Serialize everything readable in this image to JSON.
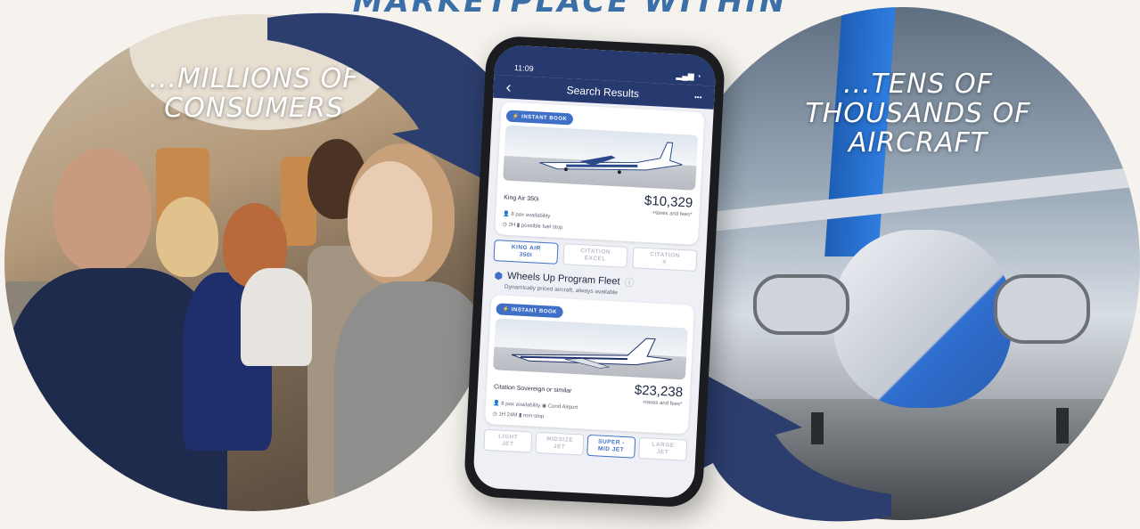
{
  "headline": "MARKETPLACE WITHIN",
  "left_panel": {
    "line1": "...MILLIONS OF",
    "line2": "CONSUMERS"
  },
  "right_panel": {
    "line1": "...TENS OF",
    "line2": "THOUSANDS OF AIRCRAFT"
  },
  "phone": {
    "status_time": "11:09",
    "nav_title": "Search Results",
    "nav_back": "‹",
    "nav_more": "•••",
    "card1": {
      "badge": "⚡ INSTANT BOOK",
      "aircraft": "King Air 350i",
      "price": "$10,329",
      "price_note": "+taxes and fees*",
      "pax": "8 pax availability",
      "duration": "2H",
      "stop": "possible fuel stop"
    },
    "chips1": [
      "KING AIR\n350I",
      "CITATION\nEXCEL",
      "CITATION\nX"
    ],
    "section": {
      "title": "Wheels Up Program Fleet",
      "subtitle": "Dynamically priced aircraft, always available"
    },
    "card2": {
      "badge": "⚡ INSTANT BOOK",
      "aircraft": "Citation Sovereign or similar",
      "price": "$23,238",
      "price_note": "+taxes and fees*",
      "pax": "8 pax availability",
      "airport": "Cond Airport",
      "duration": "1H 24M",
      "stop": "non-stop"
    },
    "chips2": [
      "LIGHT\nJET",
      "MIDSIZE\nJET",
      "SUPER -\nMID JET",
      "LARGE\nJET"
    ]
  },
  "colors": {
    "arrow": "#2c3e6e",
    "accent": "#3f6fc7",
    "headline": "#3b6fa8"
  }
}
